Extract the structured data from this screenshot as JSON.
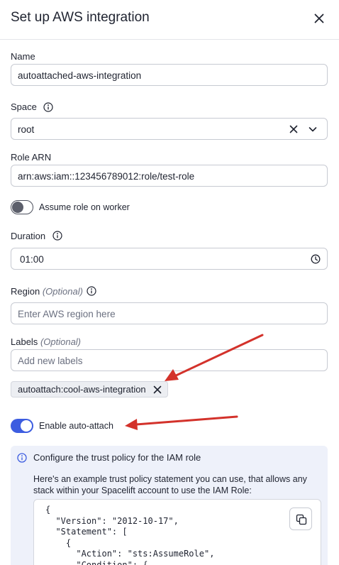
{
  "dialog": {
    "title": "Set up AWS integration"
  },
  "form": {
    "name": {
      "label": "Name",
      "value": "autoattached-aws-integration"
    },
    "space": {
      "label": "Space",
      "value": "root"
    },
    "role_arn": {
      "label": "Role ARN",
      "value": "arn:aws:iam::123456789012:role/test-role"
    },
    "assume_role_on_worker": {
      "label": "Assume role on worker",
      "enabled": false
    },
    "duration": {
      "label": "Duration",
      "value": "01:00"
    },
    "region": {
      "label": "Region",
      "optional": "(Optional)",
      "placeholder": "Enter AWS region here"
    },
    "labels": {
      "label": "Labels",
      "optional": "(Optional)",
      "placeholder": "Add new labels",
      "tags": [
        "autoattach:cool-aws-integration"
      ]
    },
    "auto_attach": {
      "label": "Enable auto-attach",
      "enabled": true
    }
  },
  "trust_policy": {
    "title": "Configure the trust policy for the IAM role",
    "description": "Here's an example trust policy statement you can use, that allows any stack within your Spacelift account to use the IAM Role:",
    "code": "{\n  \"Version\": \"2012-10-17\",\n  \"Statement\": [\n    {\n      \"Action\": \"sts:AssumeRole\",\n      \"Condition\": {"
  },
  "colors": {
    "accent": "#3d5de0",
    "arrow": "#d3322b",
    "panel_bg": "#eef1fa"
  }
}
